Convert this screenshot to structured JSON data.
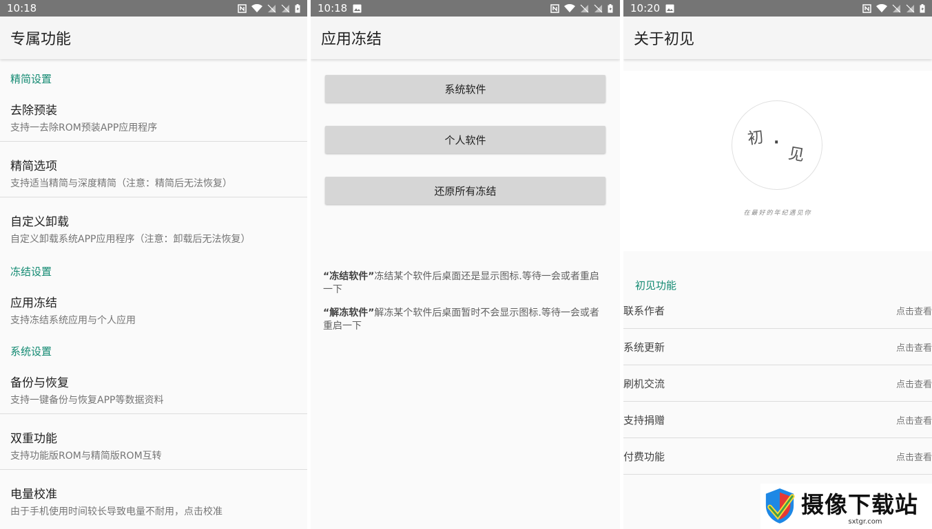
{
  "panels": [
    {
      "time": "10:18",
      "title": "专属功能",
      "sections": [
        {
          "header": "精简设置",
          "items": [
            {
              "title": "去除预装",
              "subtitle": "支持一去除ROM预装APP应用程序"
            },
            {
              "title": "精简选项",
              "subtitle": "支持适当精简与深度精简（注意：精简后无法恢复）"
            },
            {
              "title": "自定义卸载",
              "subtitle": "自定义卸载系统APP应用程序（注意：卸载后无法恢复）"
            }
          ]
        },
        {
          "header": "冻结设置",
          "items": [
            {
              "title": "应用冻结",
              "subtitle": "支持冻结系统应用与个人应用"
            }
          ]
        },
        {
          "header": "系统设置",
          "items": [
            {
              "title": "备份与恢复",
              "subtitle": "支持一键备份与恢复APP等数据资料"
            },
            {
              "title": "双重功能",
              "subtitle": "支持功能版ROM与精简版ROM互转"
            },
            {
              "title": "电量校准",
              "subtitle": "由于手机使用时间较长导致电量不耐用，点击校准"
            }
          ]
        }
      ]
    },
    {
      "time": "10:18",
      "title": "应用冻结",
      "buttons": [
        "系统软件",
        "个人软件",
        "还原所有冻结"
      ],
      "notes": [
        {
          "term": "“冻结软件”",
          "text": "冻结某个软件后桌面还是显示图标.等待一会或者重启一下"
        },
        {
          "term": "“解冻软件”",
          "text": "解冻某个软件后桌面暂时不会显示图标.等待一会或者重启一下"
        }
      ]
    },
    {
      "time": "10:20",
      "title": "关于初见",
      "logo_text": {
        "char1": "初",
        "dot": "·",
        "char2": "见",
        "tagline": "在最好的年纪遇见你"
      },
      "section": "初见功能",
      "rows": [
        {
          "label": "联系作者",
          "action": "点击查看"
        },
        {
          "label": "系统更新",
          "action": "点击查看"
        },
        {
          "label": "刷机交流",
          "action": "点击查看"
        },
        {
          "label": "支持捐赠",
          "action": "点击查看"
        },
        {
          "label": "付费功能",
          "action": "点击查看"
        }
      ]
    }
  ],
  "watermark": {
    "brand": "摄像下载站",
    "url": "sxtgr.com"
  },
  "colors": {
    "accent": "#138a72",
    "statusbar": "#757575",
    "button": "#d6d6d6"
  }
}
